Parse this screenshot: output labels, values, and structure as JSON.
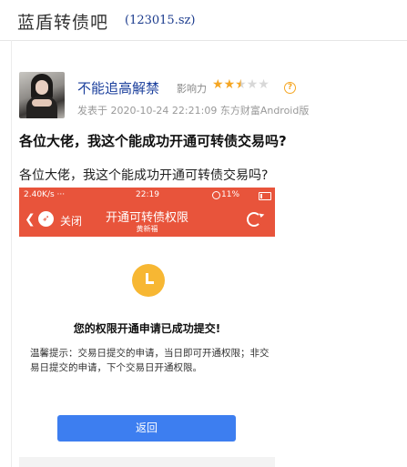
{
  "header": {
    "title": "蓝盾转债吧",
    "code": "(123015.sz)"
  },
  "post": {
    "username": "不能追高解禁",
    "influence_label": "影响力",
    "rating": {
      "value": 2.5,
      "max": 5
    },
    "meta": "发表于 2020-10-24 22:21:09 东方财富Android版",
    "title": "各位大佬，我这个能成功开通可转债交易吗?",
    "body": "各位大佬，我这个能成功开通可转债交易吗?"
  },
  "screenshot": {
    "status": {
      "left": "2.40K/s ···",
      "time": "22:19",
      "battery": "11%"
    },
    "nav": {
      "close": "关闭",
      "title": "开通可转债权限",
      "subtitle": "黄新福"
    },
    "success_title": "您的权限开通申请已成功提交!",
    "tips": "温馨提示：交易日提交的申请，当日即可开通权限；非交易日提交的申请，下个交易日开通权限。",
    "back_button": "返回"
  },
  "colors": {
    "accent_red": "#e8543b",
    "button_blue": "#3d7ef0",
    "star": "#f5a623",
    "link": "#1b3f9c"
  },
  "icons": [
    "avatar",
    "star-icon",
    "help-icon",
    "back-icon",
    "app-logo-icon",
    "refresh-icon",
    "clock-icon",
    "pending-icon"
  ]
}
